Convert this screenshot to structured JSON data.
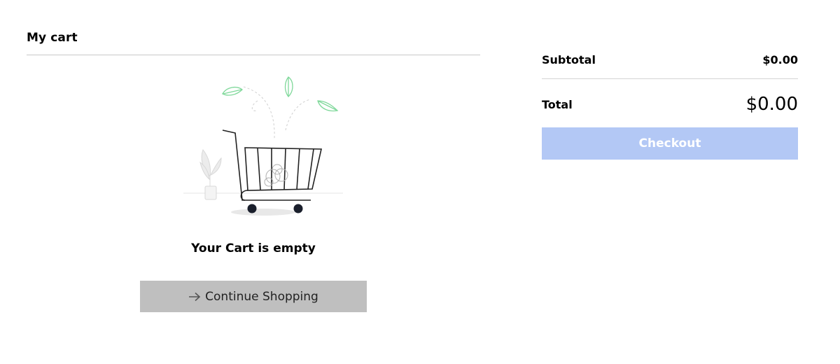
{
  "cart": {
    "title": "My cart",
    "empty_message": "Your Cart is empty",
    "continue_label": "Continue Shopping"
  },
  "summary": {
    "subtotal_label": "Subtotal",
    "subtotal_value": "$0.00",
    "total_label": "Total",
    "total_value": "$0.00",
    "checkout_label": "Checkout"
  },
  "colors": {
    "continue_button_bg": "#bfbfbf",
    "checkout_button_bg": "#b3c8f5",
    "leaf_green": "#7fd89a",
    "divider": "#c9c9c9"
  },
  "icons": {
    "continue": "arrow-right-icon",
    "illustration": "empty-cart-illustration"
  }
}
